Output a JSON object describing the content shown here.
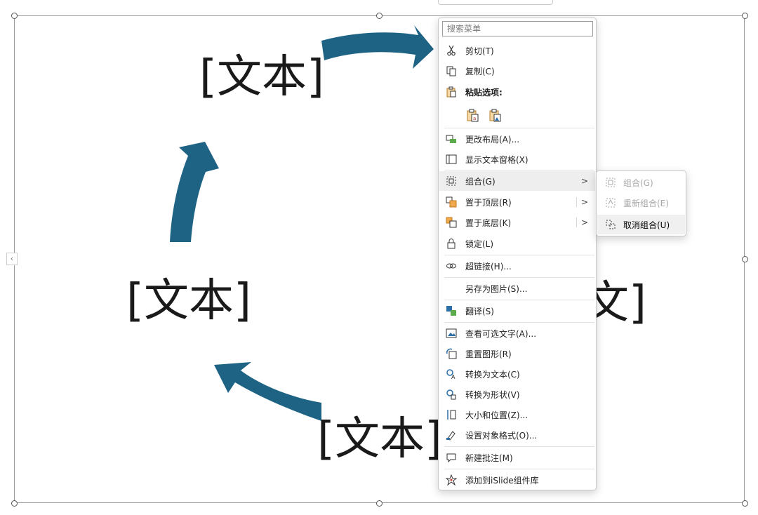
{
  "slide": {
    "text_top": "[文本]",
    "text_left": "[文本]",
    "text_bottom": "[文本]",
    "text_right_partial": "文]",
    "arrow_color": "#1e6384"
  },
  "context_menu": {
    "search_placeholder": "搜索菜单",
    "items": {
      "cut": "剪切(T)",
      "copy": "复制(C)",
      "paste_options": "粘贴选项:",
      "change_layout": "更改布局(A)...",
      "show_text_pane": "显示文本窗格(X)",
      "group": "组合(G)",
      "bring_to_front": "置于顶层(R)",
      "send_to_back": "置于底层(K)",
      "lock": "锁定(L)",
      "hyperlink": "超链接(H)...",
      "save_as_picture": "另存为图片(S)...",
      "translate": "翻译(S)",
      "view_alt_text": "查看可选文字(A)...",
      "reset_graphic": "重置图形(R)",
      "convert_to_text": "转换为文本(C)",
      "convert_to_shapes": "转换为形状(V)",
      "size_and_position": "大小和位置(Z)...",
      "format_object": "设置对象格式(O)...",
      "new_comment": "新建批注(M)",
      "add_to_islide": "添加到iSlide组件库"
    },
    "submenu_arrow": ">"
  },
  "group_submenu": {
    "group": "组合(G)",
    "regroup": "重新组合(E)",
    "ungroup": "取消组合(U)"
  },
  "collapse_glyph": "‹"
}
